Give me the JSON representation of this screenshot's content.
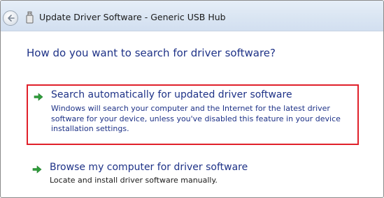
{
  "window": {
    "title": "Update Driver Software - Generic USB Hub"
  },
  "icons": {
    "back": "back-arrow-icon",
    "device": "usb-device-icon",
    "option_arrow": "green-arrow-icon"
  },
  "heading": "How do you want to search for driver software?",
  "options": [
    {
      "title": "Search automatically for updated driver software",
      "description": "Windows will search your computer and the Internet for the latest driver software for your device, unless you've disabled this feature in your device installation settings.",
      "highlighted": true
    },
    {
      "title": "Browse my computer for driver software",
      "description": "Locate and install driver software manually.",
      "highlighted": false
    }
  ],
  "colors": {
    "link": "#1e3287",
    "highlight_border": "#e0202a",
    "arrow": "#2f9e3a"
  }
}
